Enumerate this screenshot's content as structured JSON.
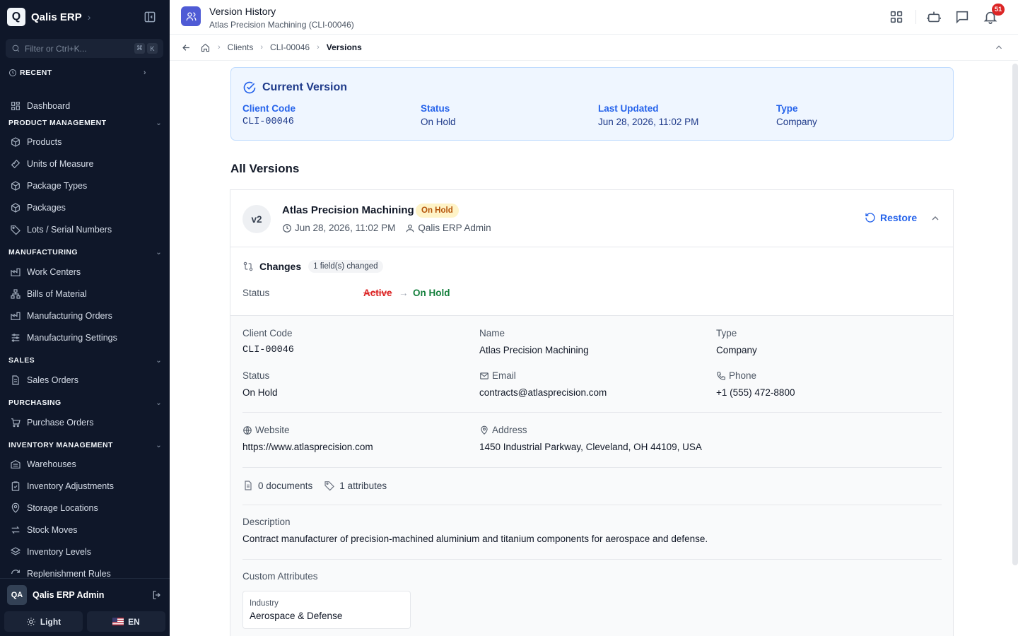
{
  "app": {
    "logo_letter": "Q",
    "name": "Qalis ERP"
  },
  "sidebar": {
    "filter_placeholder": "Filter or Ctrl+K...",
    "kbd": [
      "⌘",
      "K"
    ],
    "recent_label": "RECENT",
    "dashboard": "Dashboard",
    "sections": [
      {
        "title": "PRODUCT MANAGEMENT",
        "items": [
          "Products",
          "Units of Measure",
          "Package Types",
          "Packages",
          "Lots / Serial Numbers"
        ]
      },
      {
        "title": "MANUFACTURING",
        "items": [
          "Work Centers",
          "Bills of Material",
          "Manufacturing Orders",
          "Manufacturing Settings"
        ]
      },
      {
        "title": "SALES",
        "items": [
          "Sales Orders"
        ]
      },
      {
        "title": "PURCHASING",
        "items": [
          "Purchase Orders"
        ]
      },
      {
        "title": "INVENTORY MANAGEMENT",
        "items": [
          "Warehouses",
          "Inventory Adjustments",
          "Storage Locations",
          "Stock Moves",
          "Inventory Levels",
          "Replenishment Rules"
        ]
      }
    ],
    "user": {
      "initials": "QA",
      "name": "Qalis ERP Admin"
    },
    "theme_label": "Light",
    "lang_label": "EN"
  },
  "header": {
    "title": "Version History",
    "subtitle": "Atlas Precision Machining (CLI-00046)",
    "notification_count": "51"
  },
  "breadcrumb": [
    "Clients",
    "CLI-00046",
    "Versions"
  ],
  "current_version": {
    "title": "Current Version",
    "fields": [
      {
        "label": "Client Code",
        "value": "CLI-00046"
      },
      {
        "label": "Status",
        "value": "On Hold"
      },
      {
        "label": "Last Updated",
        "value": "Jun 28, 2026, 11:02 PM"
      },
      {
        "label": "Type",
        "value": "Company"
      }
    ]
  },
  "all_versions_title": "All Versions",
  "version": {
    "tag": "v2",
    "name": "Atlas Precision Machining",
    "status_badge": "On Hold",
    "timestamp": "Jun 28, 2026, 11:02 PM",
    "author": "Qalis ERP Admin",
    "restore_label": "Restore",
    "changes_title": "Changes",
    "changes_count": "1 field(s) changed",
    "change": {
      "field": "Status",
      "old": "Active",
      "new": "On Hold"
    },
    "details": {
      "client_code_label": "Client Code",
      "client_code": "CLI-00046",
      "name_label": "Name",
      "name": "Atlas Precision Machining",
      "type_label": "Type",
      "type": "Company",
      "status_label": "Status",
      "status": "On Hold",
      "email_label": "Email",
      "email": "contracts@atlasprecision.com",
      "phone_label": "Phone",
      "phone": "+1 (555) 472-8800",
      "website_label": "Website",
      "website": "https://www.atlasprecision.com",
      "address_label": "Address",
      "address": "1450 Industrial Parkway, Cleveland, OH 44109, USA",
      "documents": "0 documents",
      "attributes": "1 attributes",
      "description_label": "Description",
      "description": "Contract manufacturer of precision-machined aluminium and titanium components for aerospace and defense.",
      "custom_attributes_label": "Custom Attributes",
      "custom_attribute": {
        "key": "Industry",
        "value": "Aerospace & Defense"
      }
    }
  }
}
